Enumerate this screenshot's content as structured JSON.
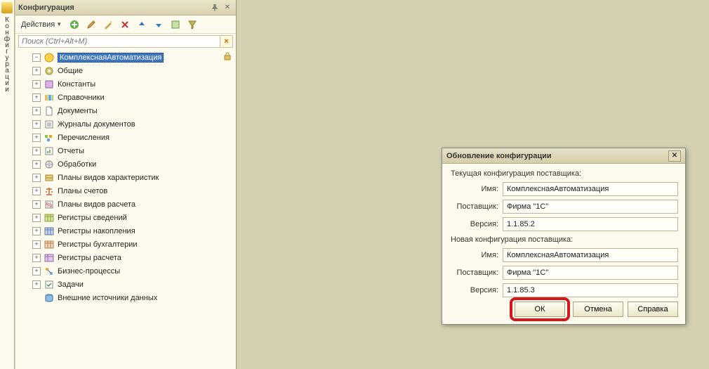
{
  "sidebar_tab": {
    "label": "Конфигурации"
  },
  "panel": {
    "title": "Конфигурация",
    "actions_label": "Действия",
    "search_placeholder": "Поиск (Ctrl+Alt+M)"
  },
  "tree": {
    "root": "КомплекснаяАвтоматизация",
    "items": [
      {
        "icon": "general",
        "label": "Общие"
      },
      {
        "icon": "constants",
        "label": "Константы"
      },
      {
        "icon": "catalogs",
        "label": "Справочники"
      },
      {
        "icon": "documents",
        "label": "Документы"
      },
      {
        "icon": "journals",
        "label": "Журналы документов"
      },
      {
        "icon": "enums",
        "label": "Перечисления"
      },
      {
        "icon": "reports",
        "label": "Отчеты"
      },
      {
        "icon": "dataprocessors",
        "label": "Обработки"
      },
      {
        "icon": "chartchar",
        "label": "Планы видов характеристик"
      },
      {
        "icon": "chartacct",
        "label": "Планы счетов"
      },
      {
        "icon": "chartcalc",
        "label": "Планы видов расчета"
      },
      {
        "icon": "inforeg",
        "label": "Регистры сведений"
      },
      {
        "icon": "accumreg",
        "label": "Регистры накопления"
      },
      {
        "icon": "acctreg",
        "label": "Регистры бухгалтерии"
      },
      {
        "icon": "calcreg",
        "label": "Регистры расчета"
      },
      {
        "icon": "bizproc",
        "label": "Бизнес-процессы"
      },
      {
        "icon": "tasks",
        "label": "Задачи"
      },
      {
        "icon": "extdata",
        "label": "Внешние источники данных",
        "no_expand": true
      }
    ]
  },
  "dialog": {
    "title": "Обновление конфигурации",
    "section1": "Текущая конфигурация поставщика:",
    "section2": "Новая конфигурация поставщика:",
    "labels": {
      "name": "Имя:",
      "vendor": "Поставщик:",
      "version": "Версия:"
    },
    "current": {
      "name": "КомплекснаяАвтоматизация",
      "vendor": "Фирма \"1С\"",
      "version": "1.1.85.2"
    },
    "newcfg": {
      "name": "КомплекснаяАвтоматизация",
      "vendor": "Фирма \"1С\"",
      "version": "1.1.85.3"
    },
    "buttons": {
      "ok": "ОК",
      "cancel": "Отмена",
      "help": "Справка"
    }
  }
}
